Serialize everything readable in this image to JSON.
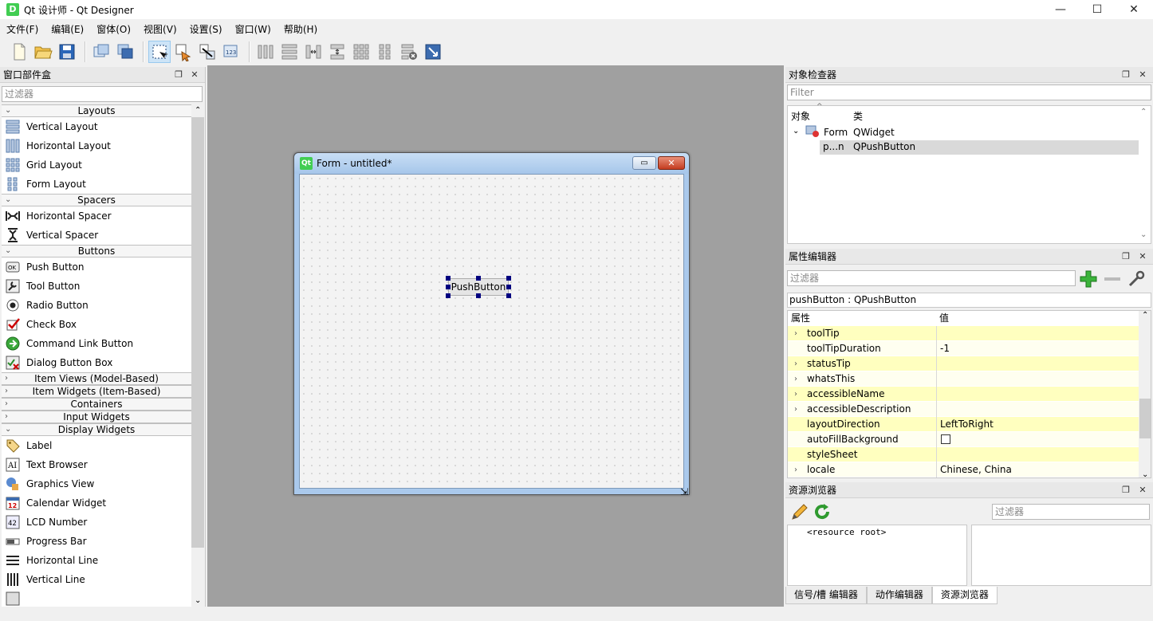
{
  "window": {
    "app_icon": "D",
    "title": "Qt 设计师 - Qt Designer",
    "minimize": "—",
    "maximize": "☐",
    "close": "✕"
  },
  "menu": [
    "文件(F)",
    "编辑(E)",
    "窗体(O)",
    "视图(V)",
    "设置(S)",
    "窗口(W)",
    "帮助(H)"
  ],
  "widget_box": {
    "title": "窗口部件盒",
    "filter_placeholder": "过滤器",
    "categories": {
      "layouts": "Layouts",
      "spacers": "Spacers",
      "buttons": "Buttons",
      "item_views": "Item Views (Model-Based)",
      "item_widgets": "Item Widgets (Item-Based)",
      "containers": "Containers",
      "input_widgets": "Input Widgets",
      "display_widgets": "Display Widgets"
    },
    "layouts": [
      "Vertical Layout",
      "Horizontal Layout",
      "Grid Layout",
      "Form Layout"
    ],
    "spacers": [
      "Horizontal Spacer",
      "Vertical Spacer"
    ],
    "buttons": [
      "Push Button",
      "Tool Button",
      "Radio Button",
      "Check Box",
      "Command Link Button",
      "Dialog Button Box"
    ],
    "display": [
      "Label",
      "Text Browser",
      "Graphics View",
      "Calendar Widget",
      "LCD Number",
      "Progress Bar",
      "Horizontal Line",
      "Vertical Line"
    ]
  },
  "form": {
    "qt_badge": "Qt",
    "title": "Form - untitled*",
    "push_button": "PushButton"
  },
  "object_inspector": {
    "title": "对象检查器",
    "filter_placeholder": "Filter",
    "col_object": "对象",
    "col_class": "类",
    "rows": [
      {
        "object": "Form",
        "class": "QWidget"
      },
      {
        "object": "p...n",
        "class": "QPushButton"
      }
    ]
  },
  "property_editor": {
    "title": "属性编辑器",
    "filter_placeholder": "过滤器",
    "object_label": "pushButton : QPushButton",
    "col_property": "属性",
    "col_value": "值",
    "rows": [
      {
        "name": "toolTip",
        "value": "",
        "expandable": true
      },
      {
        "name": "toolTipDuration",
        "value": "-1",
        "expandable": false
      },
      {
        "name": "statusTip",
        "value": "",
        "expandable": true
      },
      {
        "name": "whatsThis",
        "value": "",
        "expandable": true
      },
      {
        "name": "accessibleName",
        "value": "",
        "expandable": true
      },
      {
        "name": "accessibleDescription",
        "value": "",
        "expandable": true
      },
      {
        "name": "layoutDirection",
        "value": "LeftToRight",
        "expandable": false
      },
      {
        "name": "autoFillBackground",
        "value": "",
        "expandable": false,
        "checkbox": true
      },
      {
        "name": "styleSheet",
        "value": "",
        "expandable": false
      },
      {
        "name": "locale",
        "value": "Chinese, China",
        "expandable": true
      }
    ]
  },
  "resource_browser": {
    "title": "资源浏览器",
    "filter_placeholder": "过滤器",
    "root": "<resource root>"
  },
  "bottom_tabs": [
    "信号/槽 编辑器",
    "动作编辑器",
    "资源浏览器"
  ],
  "colors": {
    "canvas_bg": "#a0a0a0",
    "property_highlight": "#ffffbf",
    "selection_handle": "#000080",
    "qt_green": "#41cd52"
  }
}
